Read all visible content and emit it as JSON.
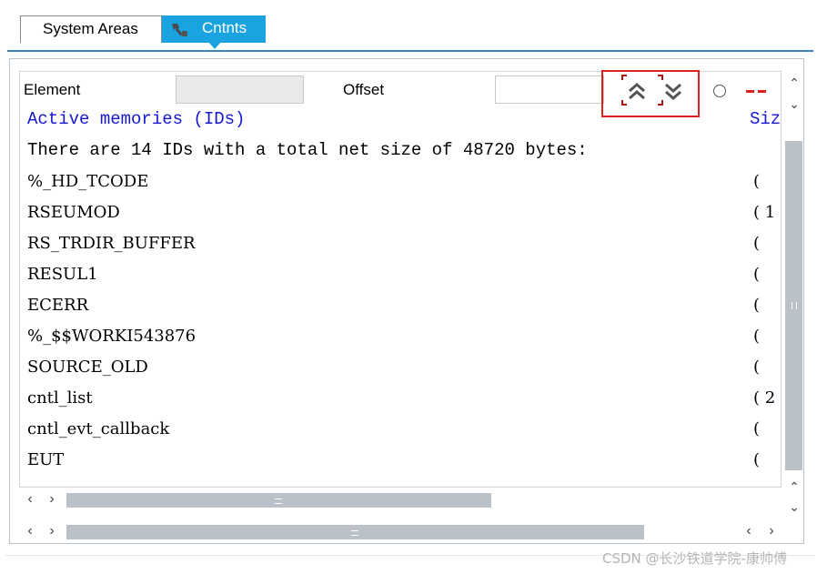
{
  "tabs": [
    {
      "label": "System Areas",
      "active": false
    },
    {
      "label": "Cntnts",
      "active": true
    }
  ],
  "toolbar": {
    "element_label": "Element",
    "element_value": "",
    "offset_label": "Offset",
    "offset_value": ""
  },
  "content": {
    "heading": "Active memories (IDs)",
    "heading_right": "Siz",
    "summary": "There are 14 IDs with a total net size of 48720 bytes:",
    "rows": [
      {
        "id": "%_HD_TCODE",
        "right": "("
      },
      {
        "id": "RSEUMOD",
        "right": "( 1"
      },
      {
        "id": "RS_TRDIR_BUFFER",
        "right": "("
      },
      {
        "id": "RESUL1",
        "right": "("
      },
      {
        "id": "ECERR",
        "right": "("
      },
      {
        "id": "%_$$WORKI543876",
        "right": "("
      },
      {
        "id": "SOURCE_OLD",
        "right": "("
      },
      {
        "id": "cntl_list",
        "right": "( 2"
      },
      {
        "id": "cntl_evt_callback",
        "right": "("
      },
      {
        "id": "EUT",
        "right": "("
      }
    ]
  },
  "icons": {
    "tab_icon": "wrench-icon",
    "scroll_up": "double-chevron-up-icon",
    "scroll_down": "double-chevron-down-icon",
    "status": "circle-icon",
    "dash": "dash-icon"
  },
  "colors": {
    "tab_active": "#1aa3e1",
    "heading_text": "#1717d0",
    "highlight": "#e02020"
  },
  "watermark": "CSDN @长沙铁道学院-康帅傅"
}
